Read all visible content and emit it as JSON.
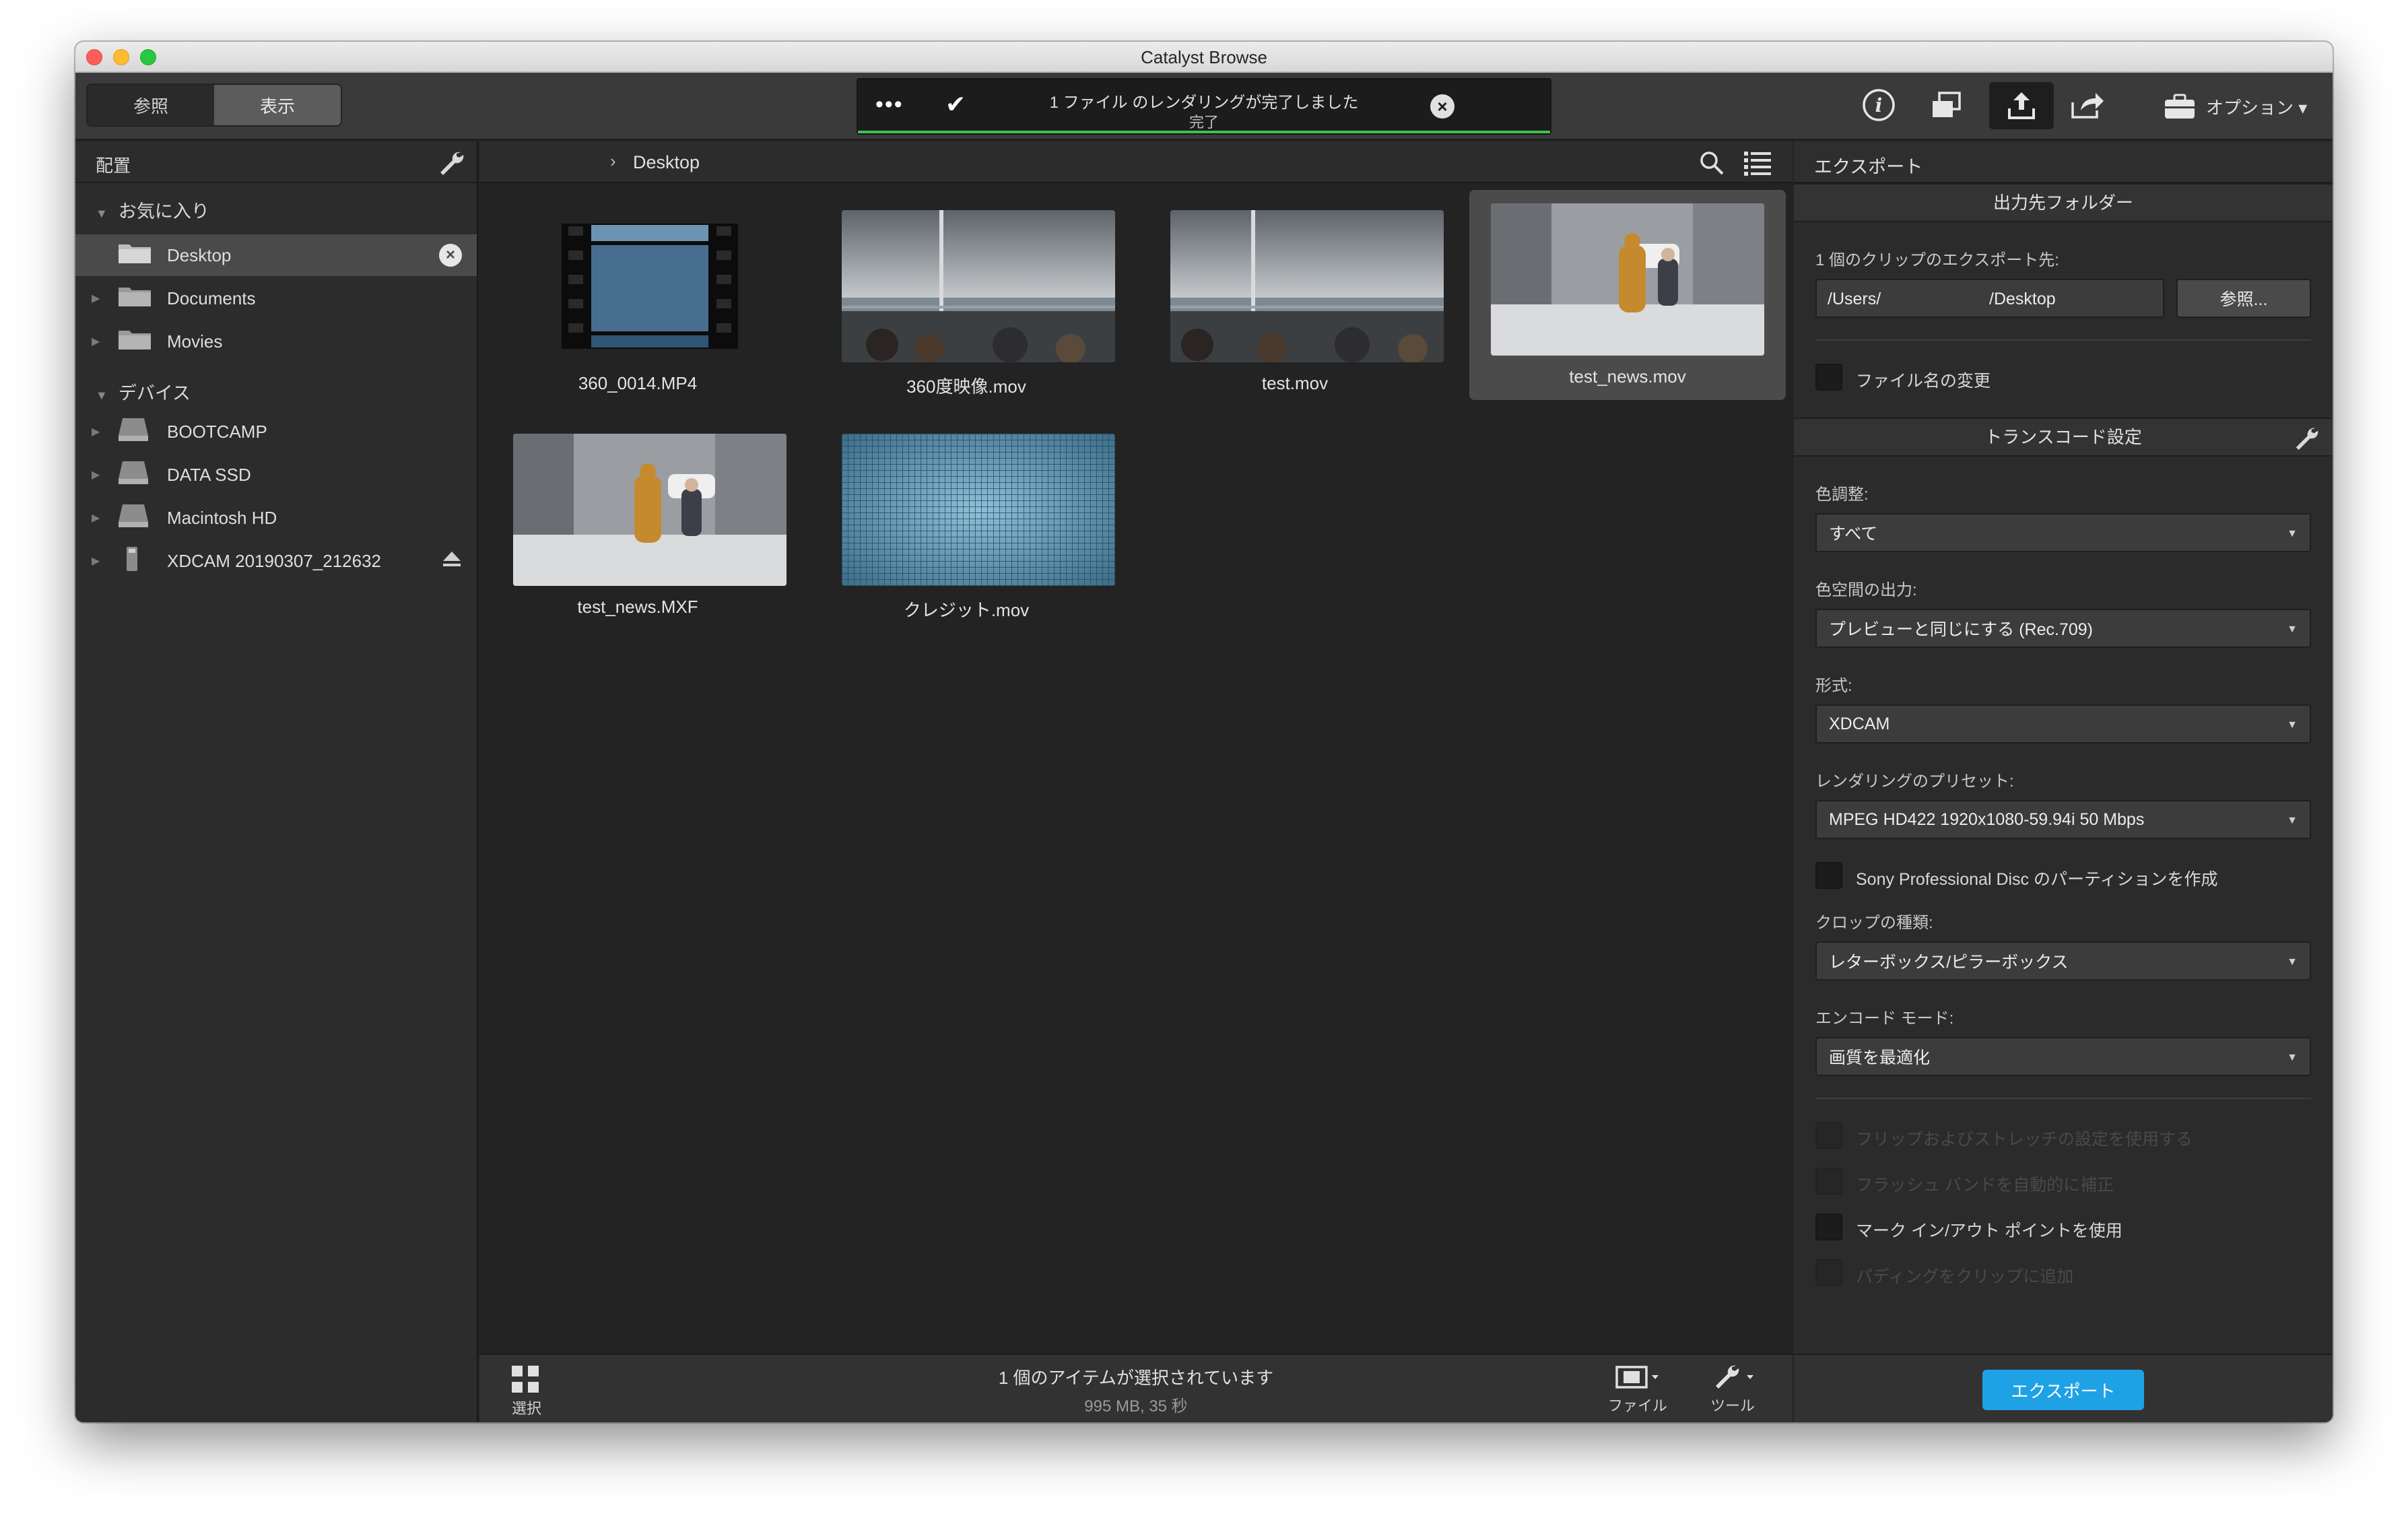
{
  "window": {
    "title": "Catalyst Browse"
  },
  "toolbar": {
    "view_tabs": [
      "参照",
      "表示"
    ],
    "status": {
      "line1": "1 ファイル のレンダリングが完了しました",
      "line2": "完了",
      "dots": "•••",
      "check": "✔",
      "progress": 1.0
    },
    "options_label": "オプション ▾"
  },
  "sidebar": {
    "header": "配置",
    "favorites_label": "お気に入り",
    "favorites": [
      "Desktop",
      "Documents",
      "Movies"
    ],
    "devices_label": "デバイス",
    "devices": [
      "BOOTCAMP",
      "DATA SSD",
      "Macintosh HD",
      "XDCAM 20190307_212632"
    ]
  },
  "browser": {
    "breadcrumb": "Desktop",
    "files": [
      {
        "name": "360_0014.MP4",
        "thumb": "film-icon"
      },
      {
        "name": "360度映像.mov",
        "thumb": "harbor"
      },
      {
        "name": "test.mov",
        "thumb": "harbor"
      },
      {
        "name": "test_news.mov",
        "thumb": "snow-street"
      },
      {
        "name": "test_news.MXF",
        "thumb": "snow-street"
      },
      {
        "name": "クレジット.mov",
        "thumb": "grid"
      }
    ]
  },
  "bottom_bar": {
    "select_label": "選択",
    "selection_text": "1 個のアイテムが選択されています",
    "selection_detail": "995 MB, 35 秒",
    "file_label": "ファイル",
    "tools_label": "ツール"
  },
  "export_panel": {
    "header": "エクスポート",
    "dest_section": "出力先フォルダー",
    "dest_label": "1 個のクリップのエクスポート先:",
    "path_prefix": "/Users/",
    "path_suffix": "/Desktop",
    "browse_label": "参照...",
    "rename_label": "ファイル名の変更",
    "transcode_section": "トランスコード設定",
    "fields": [
      {
        "label": "色調整:",
        "value": "すべて"
      },
      {
        "label": "色空間の出力:",
        "value": "プレビューと同じにする (Rec.709)"
      },
      {
        "label": "形式:",
        "value": "XDCAM"
      },
      {
        "label": "レンダリングのプリセット:",
        "value": "MPEG HD422 1920x1080-59.94i 50 Mbps"
      }
    ],
    "partition_label": "Sony Professional Disc のパーティションを作成",
    "crop_label": "クロップの種類:",
    "crop_value": "レターボックス/ピラーボックス",
    "encode_label": "エンコード モード:",
    "encode_value": "画質を最適化",
    "options": [
      {
        "label": "フリップおよびストレッチの設定を使用する",
        "enabled": false
      },
      {
        "label": "フラッシュ バンドを自動的に補正",
        "enabled": false
      },
      {
        "label": "マーク イン/アウト ポイントを使用",
        "enabled": true
      },
      {
        "label": "パディングをクリップに追加",
        "enabled": false
      }
    ],
    "export_button": "エクスポート"
  },
  "colors": {
    "accent": "#1fa1e6",
    "progress": "#3fbf4f",
    "window_bg": "#232323"
  }
}
